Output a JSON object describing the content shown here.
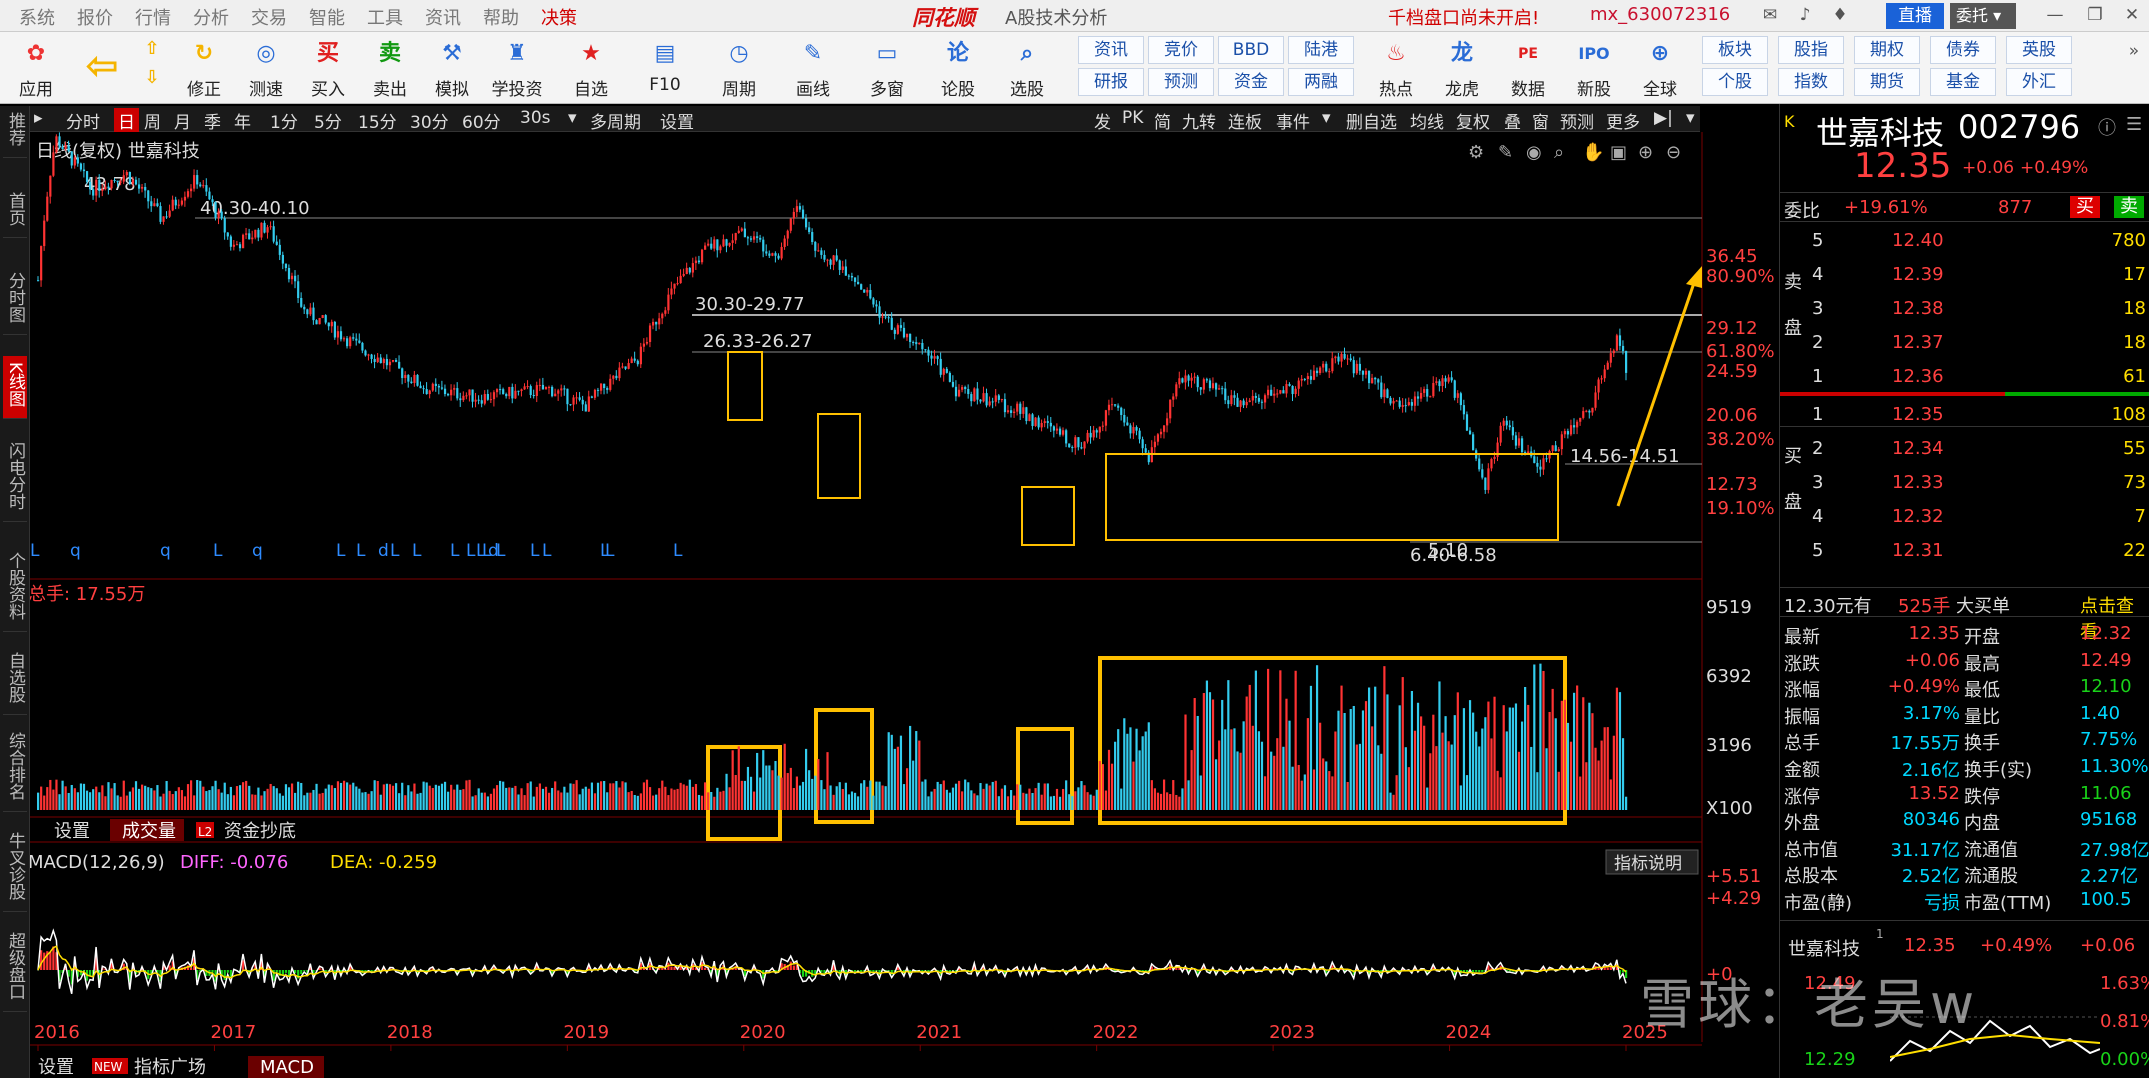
{
  "titlebar": {
    "menus": [
      "系统",
      "报价",
      "行情",
      "分析",
      "交易",
      "智能",
      "工具",
      "资讯",
      "帮助",
      "决策"
    ],
    "brand": "同花顺",
    "app": "A股技术分析",
    "notice": "千档盘口尚未开启!",
    "user": "mx_630072316",
    "live": "直播",
    "entrust": "委托"
  },
  "toolbar": {
    "buttons": [
      "应用",
      "修正",
      "测速",
      "买入",
      "卖出",
      "模拟",
      "学投资",
      "自选",
      "F10",
      "周期",
      "画线",
      "多窗",
      "论股",
      "选股",
      "热点",
      "龙虎",
      "数据",
      "新股",
      "全球"
    ],
    "grid": [
      [
        "资讯",
        "竞价",
        "BBD",
        "陆港"
      ],
      [
        "研报",
        "预测",
        "资金",
        "两融"
      ]
    ],
    "grid2": [
      [
        "板块",
        "股指",
        "期权",
        "债券",
        "英股"
      ],
      [
        "个股",
        "指数",
        "期货",
        "基金",
        "外汇"
      ]
    ]
  },
  "chart_toolbar": {
    "left": [
      "分时",
      "日",
      "周",
      "月",
      "季",
      "年",
      "1分",
      "5分",
      "15分",
      "30分",
      "60分",
      "30s",
      "多周期",
      "设置"
    ],
    "right": [
      "发",
      "PK",
      "简",
      "九转",
      "连板",
      "事件",
      "删自选",
      "均线",
      "复权",
      "叠",
      "窗",
      "预测",
      "更多"
    ]
  },
  "left_tabs": [
    "推荐",
    "首页",
    "分时图",
    "K线图",
    "闪电分时",
    "个股资料",
    "自选股",
    "综合排名",
    "牛叉诊股",
    "超级盘口"
  ],
  "chart": {
    "title": "日线(复权)  世嘉科技",
    "price_labels": [
      "36.45",
      "29.12",
      "24.59",
      "20.06",
      "12.73"
    ],
    "pct_labels": [
      "80.90%",
      "61.80%",
      "38.20%",
      "19.10%"
    ],
    "annotations": [
      "43.78",
      "40.30-40.10",
      "30.30-29.77",
      "26.33-26.27",
      "14.56-14.51",
      "6.40-6.58",
      "5.10"
    ],
    "markers": [
      "L",
      "q",
      "q",
      "L",
      "q",
      "L",
      "L",
      "d",
      "L",
      "L",
      "L",
      "L",
      "L",
      "L",
      "d",
      "L",
      "L",
      "L",
      "L",
      "L",
      "L"
    ],
    "vol_title": "总手: 17.55万",
    "vol_labels": [
      "9519",
      "6392",
      "3196",
      "X100"
    ],
    "vol_tabs": [
      "设置",
      "成交量",
      "资金抄底"
    ],
    "macd_title": "MACD(12,26,9)",
    "diff": "DIFF: -0.076",
    "dea": "DEA: -0.259",
    "macd_labels": [
      "+5.51",
      "+4.29",
      "+0"
    ],
    "macd_help": "指标说明",
    "years": [
      "2016",
      "2017",
      "2018",
      "2019",
      "2020",
      "2021",
      "2022",
      "2023",
      "2024",
      "2025"
    ],
    "bottom_tabs": [
      "设置",
      "指标广场",
      "MACD"
    ],
    "new_badge": "NEW"
  },
  "chart_data": {
    "type": "candlestick",
    "title": "日线(复权) 世嘉科技",
    "x_range": [
      "2016",
      "2025"
    ],
    "price_range": [
      5.1,
      43.78
    ],
    "price_series": [
      {
        "year": 2016.0,
        "v": 20
      },
      {
        "year": 2016.1,
        "v": 43.78
      },
      {
        "year": 2016.3,
        "v": 33
      },
      {
        "year": 2016.5,
        "v": 36
      },
      {
        "year": 2016.7,
        "v": 28
      },
      {
        "year": 2016.9,
        "v": 35
      },
      {
        "year": 2017.1,
        "v": 24
      },
      {
        "year": 2017.3,
        "v": 27
      },
      {
        "year": 2017.5,
        "v": 17
      },
      {
        "year": 2017.8,
        "v": 14
      },
      {
        "year": 2018.2,
        "v": 11
      },
      {
        "year": 2018.5,
        "v": 10.5
      },
      {
        "year": 2018.9,
        "v": 11
      },
      {
        "year": 2019.1,
        "v": 10
      },
      {
        "year": 2019.4,
        "v": 13
      },
      {
        "year": 2019.6,
        "v": 19
      },
      {
        "year": 2019.8,
        "v": 24
      },
      {
        "year": 2020.0,
        "v": 26
      },
      {
        "year": 2020.2,
        "v": 23
      },
      {
        "year": 2020.3,
        "v": 30.3
      },
      {
        "year": 2020.4,
        "v": 24
      },
      {
        "year": 2020.6,
        "v": 21
      },
      {
        "year": 2020.8,
        "v": 16
      },
      {
        "year": 2021.0,
        "v": 14
      },
      {
        "year": 2021.2,
        "v": 11
      },
      {
        "year": 2021.5,
        "v": 10
      },
      {
        "year": 2021.9,
        "v": 8
      },
      {
        "year": 2022.1,
        "v": 10
      },
      {
        "year": 2022.3,
        "v": 7.5
      },
      {
        "year": 2022.5,
        "v": 12
      },
      {
        "year": 2022.8,
        "v": 10
      },
      {
        "year": 2023.1,
        "v": 11
      },
      {
        "year": 2023.4,
        "v": 13
      },
      {
        "year": 2023.7,
        "v": 10
      },
      {
        "year": 2024.0,
        "v": 11.5
      },
      {
        "year": 2024.2,
        "v": 6.4
      },
      {
        "year": 2024.3,
        "v": 9
      },
      {
        "year": 2024.5,
        "v": 7
      },
      {
        "year": 2024.8,
        "v": 10
      },
      {
        "year": 2024.95,
        "v": 14.5
      },
      {
        "year": 2025.0,
        "v": 12.35
      }
    ],
    "volume_range": [
      0,
      9519
    ]
  },
  "quote": {
    "name": "世嘉科技",
    "code": "002796",
    "price": "12.35",
    "chg": "+0.06",
    "pct": "+0.49%",
    "weibi_label": "委比",
    "weibi": "+19.61%",
    "weicha": "877",
    "buy_btn": "买",
    "sell_btn": "卖",
    "sell_side": "卖盘",
    "buy_side": "买盘",
    "asks": [
      {
        "n": "5",
        "p": "12.40",
        "v": "780"
      },
      {
        "n": "4",
        "p": "12.39",
        "v": "17"
      },
      {
        "n": "3",
        "p": "12.38",
        "v": "18"
      },
      {
        "n": "2",
        "p": "12.37",
        "v": "18"
      },
      {
        "n": "1",
        "p": "12.36",
        "v": "61"
      }
    ],
    "bids": [
      {
        "n": "1",
        "p": "12.35",
        "v": "108"
      },
      {
        "n": "2",
        "p": "12.34",
        "v": "55"
      },
      {
        "n": "3",
        "p": "12.33",
        "v": "73"
      },
      {
        "n": "4",
        "p": "12.32",
        "v": "7"
      },
      {
        "n": "5",
        "p": "12.31",
        "v": "22"
      }
    ],
    "bigorder": [
      "12.30元有",
      "525手",
      "大买单",
      "点击查看"
    ],
    "stats": [
      [
        "最新",
        "12.35",
        "开盘",
        "12.32"
      ],
      [
        "涨跌",
        "+0.06",
        "最高",
        "12.49"
      ],
      [
        "涨幅",
        "+0.49%",
        "最低",
        "12.10"
      ],
      [
        "振幅",
        "3.17%",
        "量比",
        "1.40"
      ],
      [
        "总手",
        "17.55万",
        "换手",
        "7.75%"
      ],
      [
        "金额",
        "2.16亿",
        "换手(实)",
        "11.30%"
      ],
      [
        "涨停",
        "13.52",
        "跌停",
        "11.06"
      ],
      [
        "外盘",
        "80346",
        "内盘",
        "95168"
      ],
      [
        "总市值",
        "31.17亿",
        "流通值",
        "27.98亿"
      ],
      [
        "总股本",
        "2.52亿",
        "流通股",
        "2.27亿"
      ],
      [
        "市盈(静)",
        "亏损",
        "市盈(TTM)",
        "100.5"
      ]
    ],
    "mini": {
      "name": "世嘉科技",
      "price": "12.35",
      "pct": "+0.49%",
      "chg": "+0.06",
      "hi": "12.49",
      "hipct": "1.63%",
      "mid": "0.81%",
      "lo": "12.29",
      "lopct": "0.00%"
    }
  },
  "watermark": "雪球：老吴w",
  "colors": {
    "up": "#ff3333",
    "down": "#33ccee",
    "box": "#ffc000",
    "macd_diff": "#ffffff",
    "macd_dea": "#ffde00"
  }
}
